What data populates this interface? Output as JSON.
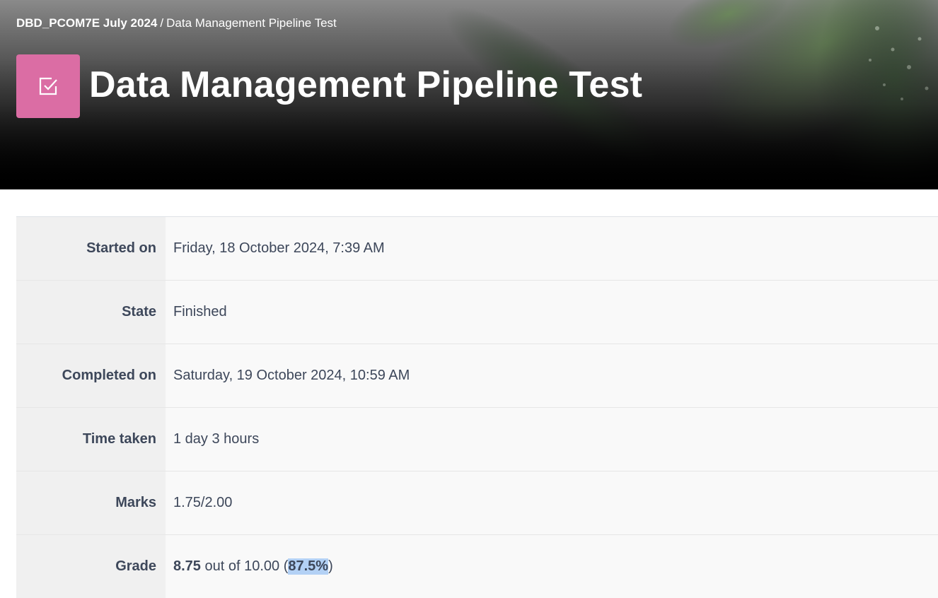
{
  "breadcrumb": {
    "course": "DBD_PCOM7E July 2024",
    "separator": "/",
    "current": "Data Management Pipeline Test"
  },
  "header": {
    "title": "Data Management Pipeline Test",
    "icon": "quiz-checkbox-icon",
    "icon_color": "#db6da4"
  },
  "summary": {
    "rows": [
      {
        "label": "Started on",
        "value": "Friday, 18 October 2024, 7:39 AM"
      },
      {
        "label": "State",
        "value": "Finished"
      },
      {
        "label": "Completed on",
        "value": "Saturday, 19 October 2024, 10:59 AM"
      },
      {
        "label": "Time taken",
        "value": "1 day 3 hours"
      },
      {
        "label": "Marks",
        "value": "1.75/2.00"
      },
      {
        "label": "Grade",
        "value": ""
      }
    ],
    "grade": {
      "score": "8.75",
      "out_of_text": " out of 10.00 (",
      "percent": "87.5%",
      "close": ")"
    }
  },
  "colors": {
    "label_bg": "#f0f0f0",
    "value_bg": "#f9f9f9",
    "text": "#3d475a",
    "selection_highlight": "#b3d1f5"
  }
}
